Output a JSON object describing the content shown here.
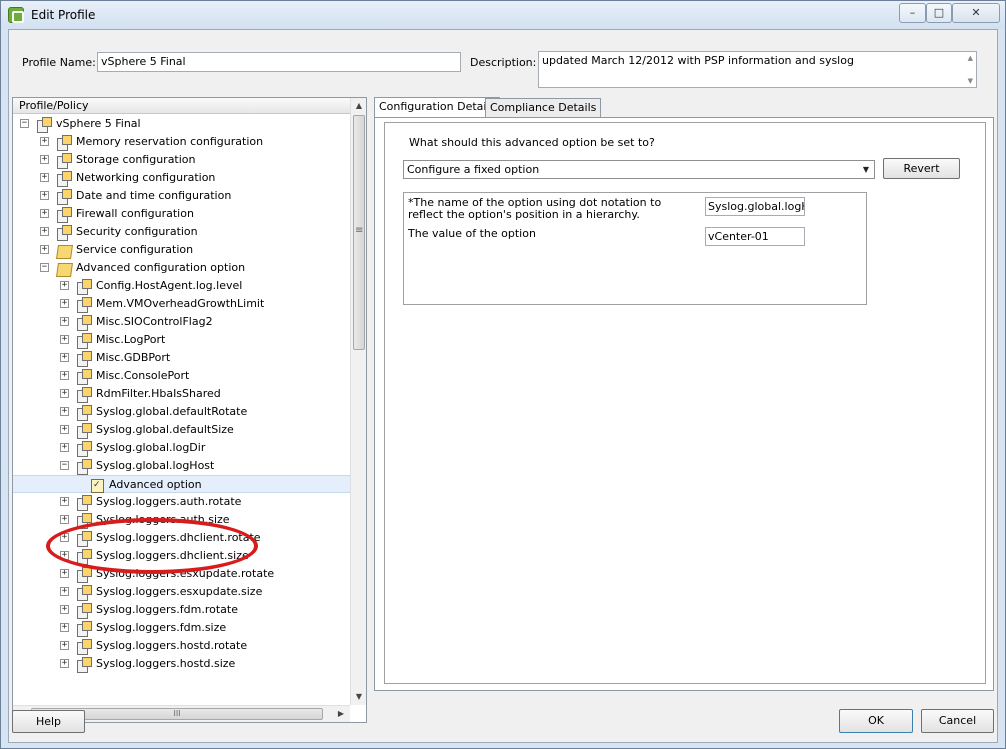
{
  "window": {
    "title": "Edit Profile",
    "controls": {
      "minimize": "–",
      "maximize": "□",
      "close": "✕"
    }
  },
  "form": {
    "profile_name_label": "Profile Name:",
    "profile_name_value": "vSphere 5 Final",
    "description_label": "Description:",
    "description_value": "updated March 12/2012 with PSP information and syslog"
  },
  "tree": {
    "header": "Profile/Policy",
    "items": [
      {
        "label": "vSphere 5 Final",
        "expander": "−"
      },
      {
        "label": "Memory reservation configuration",
        "expander": "+"
      },
      {
        "label": "Storage configuration",
        "expander": "+"
      },
      {
        "label": "Networking configuration",
        "expander": "+"
      },
      {
        "label": "Date and time configuration",
        "expander": "+"
      },
      {
        "label": "Firewall configuration",
        "expander": "+"
      },
      {
        "label": "Security configuration",
        "expander": "+"
      },
      {
        "label": "Service configuration",
        "expander": "+"
      },
      {
        "label": "Advanced configuration option",
        "expander": "−"
      },
      {
        "label": "Config.HostAgent.log.level",
        "expander": "+"
      },
      {
        "label": "Mem.VMOverheadGrowthLimit",
        "expander": "+"
      },
      {
        "label": "Misc.SIOControlFlag2",
        "expander": "+"
      },
      {
        "label": "Misc.LogPort",
        "expander": "+"
      },
      {
        "label": "Misc.GDBPort",
        "expander": "+"
      },
      {
        "label": "Misc.ConsolePort",
        "expander": "+"
      },
      {
        "label": "RdmFilter.HbaIsShared",
        "expander": "+"
      },
      {
        "label": "Syslog.global.defaultRotate",
        "expander": "+"
      },
      {
        "label": "Syslog.global.defaultSize",
        "expander": "+"
      },
      {
        "label": "Syslog.global.logDir",
        "expander": "+"
      },
      {
        "label": "Syslog.global.logHost",
        "expander": "−"
      },
      {
        "label": "Advanced option",
        "expander": ""
      },
      {
        "label": "Syslog.loggers.auth.rotate",
        "expander": "+"
      },
      {
        "label": "Syslog.loggers.auth.size",
        "expander": "+"
      },
      {
        "label": "Syslog.loggers.dhclient.rotate",
        "expander": "+"
      },
      {
        "label": "Syslog.loggers.dhclient.size",
        "expander": "+"
      },
      {
        "label": "Syslog.loggers.esxupdate.rotate",
        "expander": "+"
      },
      {
        "label": "Syslog.loggers.esxupdate.size",
        "expander": "+"
      },
      {
        "label": "Syslog.loggers.fdm.rotate",
        "expander": "+"
      },
      {
        "label": "Syslog.loggers.fdm.size",
        "expander": "+"
      },
      {
        "label": "Syslog.loggers.hostd.rotate",
        "expander": "+"
      },
      {
        "label": "Syslog.loggers.hostd.size",
        "expander": "+"
      }
    ],
    "hscroll_grip": "III"
  },
  "tabs": [
    {
      "label": "Configuration Details",
      "active": true
    },
    {
      "label": "Compliance Details",
      "active": false
    }
  ],
  "config": {
    "question": "What should this advanced option be set to?",
    "selected_option": "Configure a fixed option",
    "revert_label": "Revert",
    "option_name_label": "*The name of the option using dot notation to reflect the option's position in a hierarchy.",
    "option_name_value": "Syslog.global.logHo",
    "option_value_label": "The value of the option",
    "option_value_value": "vCenter-01"
  },
  "buttons": {
    "help": "Help",
    "ok": "OK",
    "cancel": "Cancel"
  },
  "colors": {
    "annotation": "#d81c1c",
    "window_bg": "#d7e4f2",
    "selected_row": "#e5eefb"
  }
}
